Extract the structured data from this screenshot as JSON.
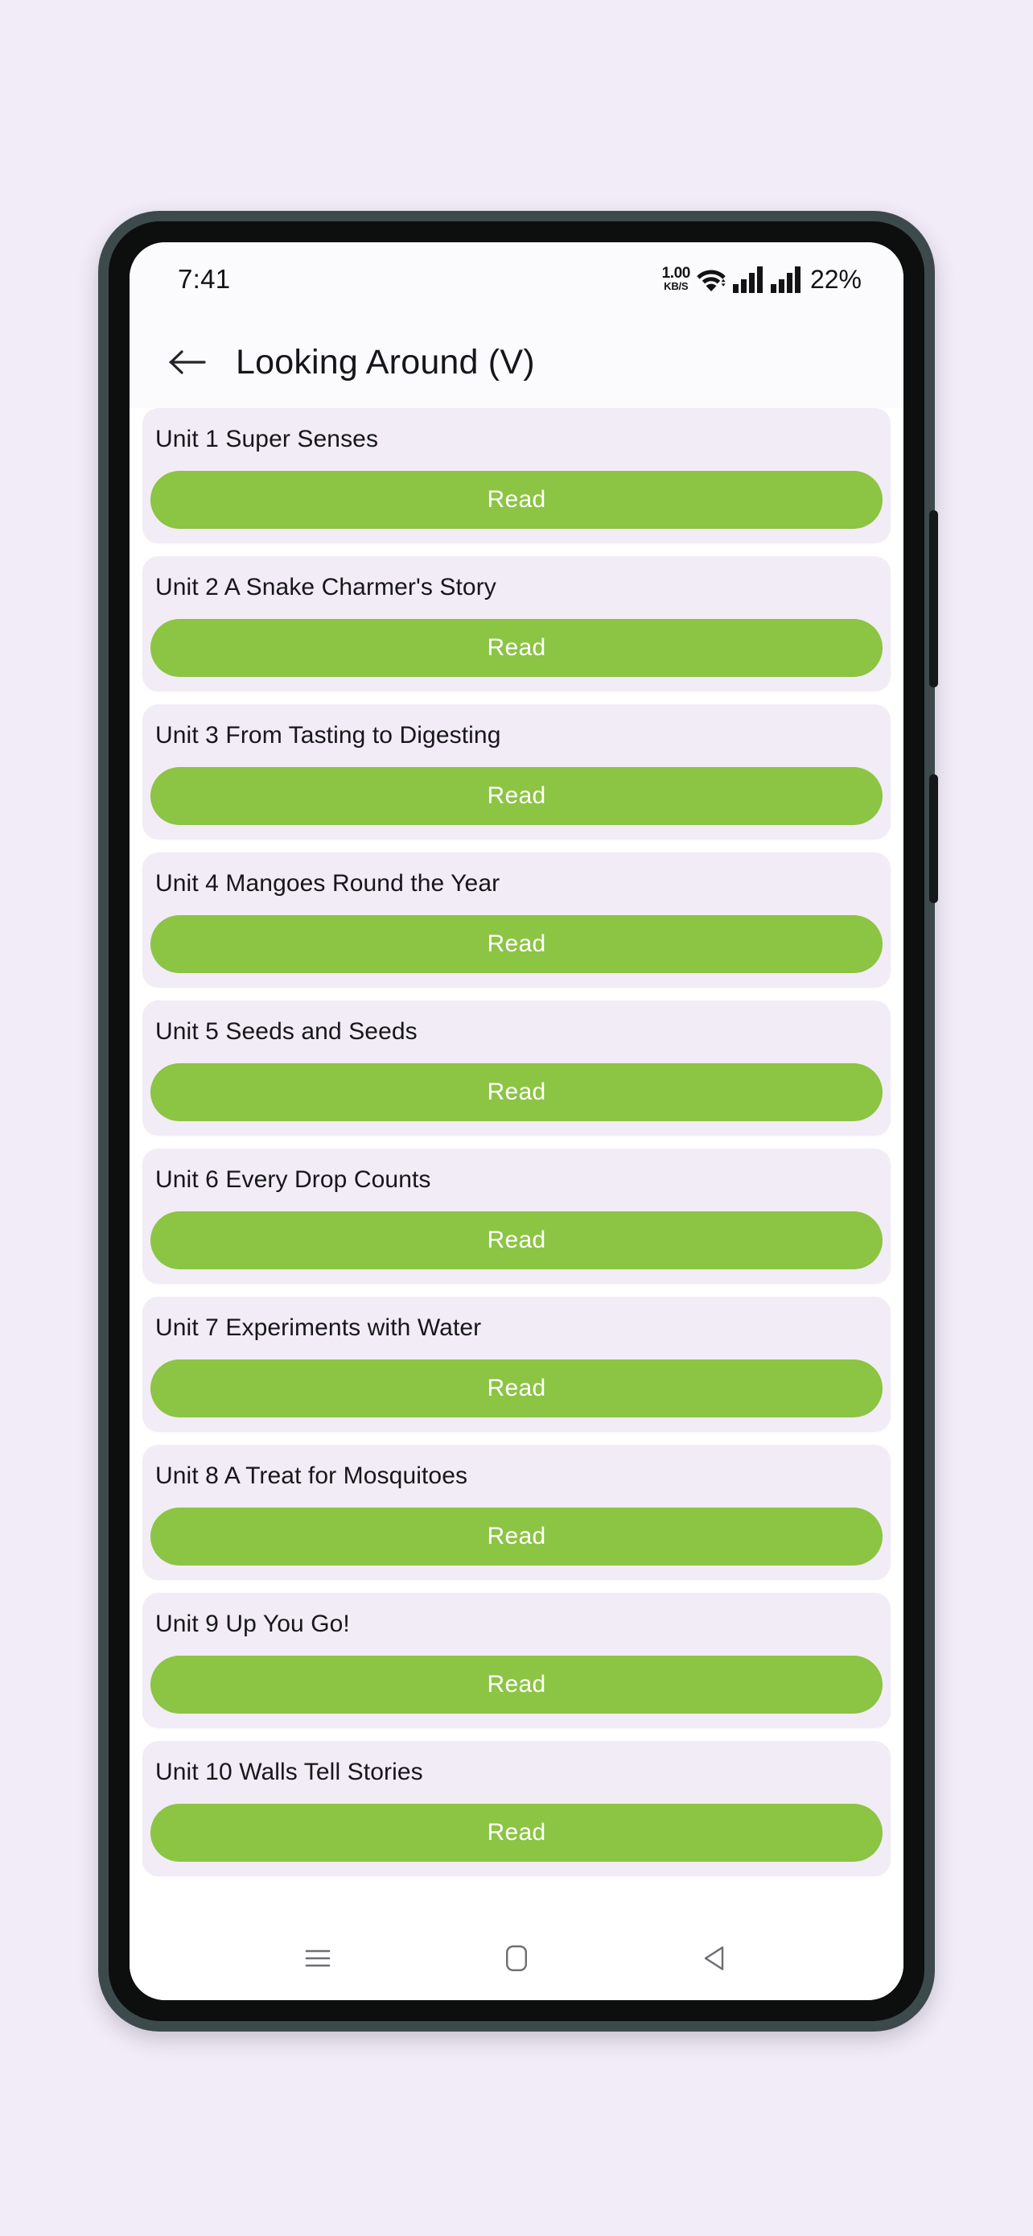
{
  "theme": {
    "page_background": "#f2ecf8",
    "frame_color": "#3c4a4c",
    "screen_background": "#ffffff",
    "card_background": "#f1ecf5",
    "accent_green": "#8cc443",
    "text_color": "#17171b"
  },
  "status_bar": {
    "time": "7:41",
    "net_speed_value": "1.00",
    "net_speed_unit": "KB/S",
    "wifi_icon": "wifi-icon",
    "signal_icon_1": "signal-bars-icon",
    "signal_icon_2": "signal-bars-icon",
    "battery_percent": "22%"
  },
  "app_bar": {
    "back_icon": "back-arrow-icon",
    "title": "Looking Around (V)"
  },
  "units": [
    {
      "title": "Unit 1  Super Senses",
      "button_label": "Read"
    },
    {
      "title": "Unit 2  A Snake Charmer's Story",
      "button_label": "Read"
    },
    {
      "title": "Unit 3  From Tasting to Digesting",
      "button_label": "Read"
    },
    {
      "title": "Unit 4  Mangoes Round the Year",
      "button_label": "Read"
    },
    {
      "title": "Unit 5  Seeds and Seeds",
      "button_label": "Read"
    },
    {
      "title": "Unit 6  Every Drop Counts",
      "button_label": "Read"
    },
    {
      "title": "Unit 7  Experiments with Water",
      "button_label": "Read"
    },
    {
      "title": "Unit 8  A Treat for Mosquitoes",
      "button_label": "Read"
    },
    {
      "title": "Unit 9  Up You Go!",
      "button_label": "Read"
    },
    {
      "title": "Unit 10  Walls Tell Stories",
      "button_label": "Read"
    }
  ],
  "nav_bar": {
    "recents_icon": "hamburger-menu-icon",
    "home_icon": "home-square-icon",
    "back_icon": "back-triangle-icon"
  }
}
